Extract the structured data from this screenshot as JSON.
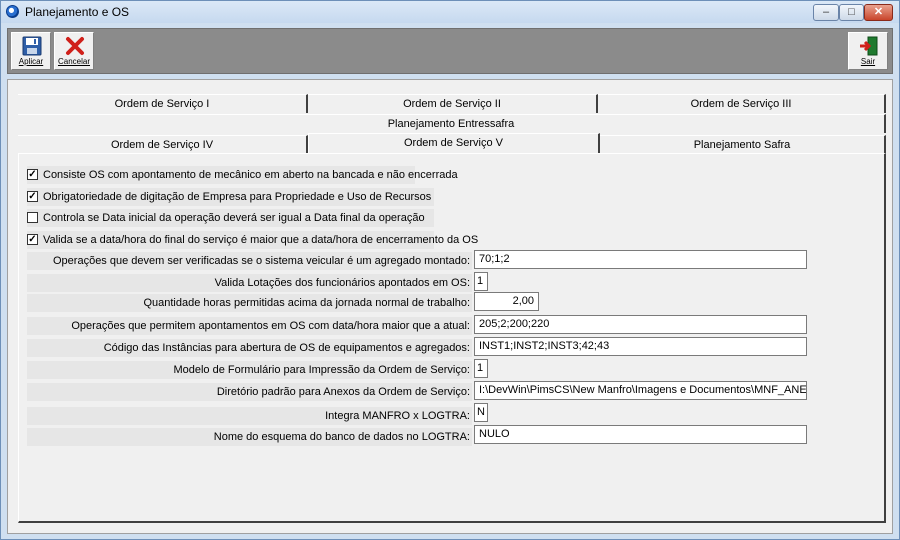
{
  "window": {
    "title": "Planejamento e OS"
  },
  "toolbar": {
    "save_label": "Aplicar",
    "cancel_label": "Cancelar",
    "exit_label": "Sair"
  },
  "tabs": {
    "row1": [
      "Ordem de Serviço I",
      "Ordem de Serviço II",
      "Ordem de Serviço III"
    ],
    "row2": [
      "Planejamento Entressafra"
    ],
    "row3": [
      "Ordem de Serviço IV",
      "Ordem de Serviço V",
      "Planejamento Safra"
    ],
    "active": "Ordem de Serviço V"
  },
  "checkboxes": [
    {
      "label": "Consiste OS com apontamento de mecânico em aberto na bancada e não encerrada",
      "checked": true
    },
    {
      "label": "Obrigatoriedade de digitação de Empresa para Propriedade e Uso de Recursos",
      "checked": true
    },
    {
      "label": "Controla se Data inicial da operação deverá ser igual a Data final da operação",
      "checked": false
    },
    {
      "label": "Valida se a data/hora do final do serviço é maior que a data/hora de encerramento da OS",
      "checked": true
    }
  ],
  "fields": [
    {
      "label": "Operações que devem ser verificadas se o sistema veicular é um agregado montado:",
      "value": "70;1;2"
    },
    {
      "label": "Valida Lotações dos funcionários apontados em OS:",
      "value": "1"
    },
    {
      "label": "Quantidade horas permitidas acima da jornada normal de trabalho:",
      "value": "2,00"
    },
    {
      "label": "Operações que permitem apontamentos em OS com data/hora maior que a atual:",
      "value": "205;2;200;220"
    },
    {
      "label": "Código das Instâncias para abertura de OS de equipamentos e agregados:",
      "value": "INST1;INST2;INST3;42;43"
    },
    {
      "label": "Modelo de Formulário para Impressão da Ordem de Serviço:",
      "value": "1"
    },
    {
      "label": "Diretório padrão para Anexos da Ordem de Serviço:",
      "value": "I:\\DevWin\\PimsCS\\New Manfro\\Imagens e Documentos\\MNF_ANEXOS_O"
    },
    {
      "label": "Integra MANFRO x LOGTRA:",
      "value": "N"
    },
    {
      "label": "Nome do esquema do banco de dados no LOGTRA:",
      "value": "NULO"
    }
  ],
  "colors": {
    "title_bar": "#c6d9ef",
    "toolbar": "#8b8b8b",
    "panel": "#f0f0f0",
    "close_button": "#c9452b"
  }
}
